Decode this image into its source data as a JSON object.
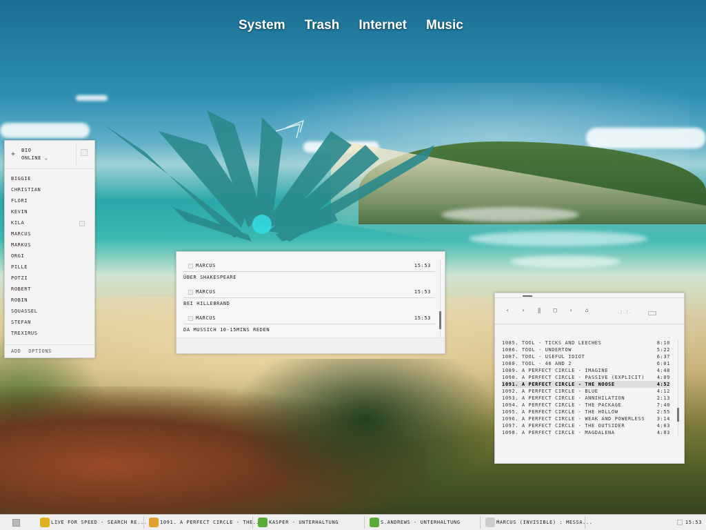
{
  "desktop_menu": [
    "System",
    "Trash",
    "Internet",
    "Music"
  ],
  "buddy_list": {
    "username": "BIO",
    "status": "ONLINE ⌄",
    "plus": "+",
    "contacts": [
      "BIGGIE",
      "CHRISTIAN",
      "FLORI",
      "KEVIN",
      "KILA",
      "MARCUS",
      "MARKUS",
      "ORGI",
      "PILLE",
      "POTZI",
      "ROBERT",
      "ROBIN",
      "SQUASSEL",
      "STEFAN",
      "TREXIRUS"
    ],
    "footer": [
      "ADD",
      "OPTIONS"
    ]
  },
  "chat": {
    "messages": [
      {
        "sender": "MARCUS",
        "time": "15:53",
        "text": "ÜBER SHAKESPEARE"
      },
      {
        "sender": "MARCUS",
        "time": "15:53",
        "text": "BEI HILLEBRAND"
      },
      {
        "sender": "MARCUS",
        "time": "15:53",
        "text": "DA MUSSICH 10-15MINS REDEN"
      }
    ]
  },
  "player": {
    "controls": [
      "‹",
      "›",
      "‖",
      "□",
      "›",
      "⌂"
    ],
    "volume": ".|.|.",
    "playlist": [
      {
        "title": "1085. TOOL - TICKS AND LEECHES",
        "duration": "8:10"
      },
      {
        "title": "1086. TOOL - UNDERTOW",
        "duration": "5:22"
      },
      {
        "title": "1087. TOOL - USEFUL IDIOT",
        "duration": "6:37"
      },
      {
        "title": "1088. TOOL - 46 AND 2",
        "duration": "6:01"
      },
      {
        "title": "1089. A PERFECT CIRCLE - IMAGINE",
        "duration": "4:48"
      },
      {
        "title": "1090. A PERFECT CIRCLE - PASSIVE (EXPLICIT)",
        "duration": "4:09"
      },
      {
        "title": "1091. A PERFECT CIRCLE - THE NOOSE",
        "duration": "4:52"
      },
      {
        "title": "1092. A PERFECT CIRCLE - BLUE",
        "duration": "4:12"
      },
      {
        "title": "1093. A PERFECT CIRCLE - ANNIHILATION",
        "duration": "2:13"
      },
      {
        "title": "1094. A PERFECT CIRCLE - THE PACKAGE",
        "duration": "7:40"
      },
      {
        "title": "1095. A PERFECT CIRCLE - THE HOLLOW",
        "duration": "2:55"
      },
      {
        "title": "1096. A PERFECT CIRCLE - WEAK AND POWERLESS",
        "duration": "3:14"
      },
      {
        "title": "1097. A PERFECT CIRCLE - THE OUTSIDER",
        "duration": "4:03"
      },
      {
        "title": "1098. A PERFECT CIRCLE - MAGDALENA",
        "duration": "4:03"
      }
    ],
    "current_index": 6
  },
  "taskbar": {
    "tasks": [
      {
        "label": "LIVE FOR SPEED - SEARCH RE...",
        "icon": "lfs-icon",
        "color": "#e0b020"
      },
      {
        "label": "1091. A PERFECT CIRCLE - THE...",
        "icon": "music-player-icon",
        "color": "#e0a030"
      },
      {
        "label": "KASPER - UNTERHALTUNG",
        "icon": "messenger-icon",
        "color": "#5aaa3a"
      },
      {
        "label": "S.ANDREWS - UNTERHALTUNG",
        "icon": "messenger-icon",
        "color": "#5aaa3a"
      },
      {
        "label": "MARCUS (INVISIBLE) : MESSA...",
        "icon": "chat-window-icon",
        "color": "#cccccc"
      }
    ],
    "clock": "15:53"
  }
}
